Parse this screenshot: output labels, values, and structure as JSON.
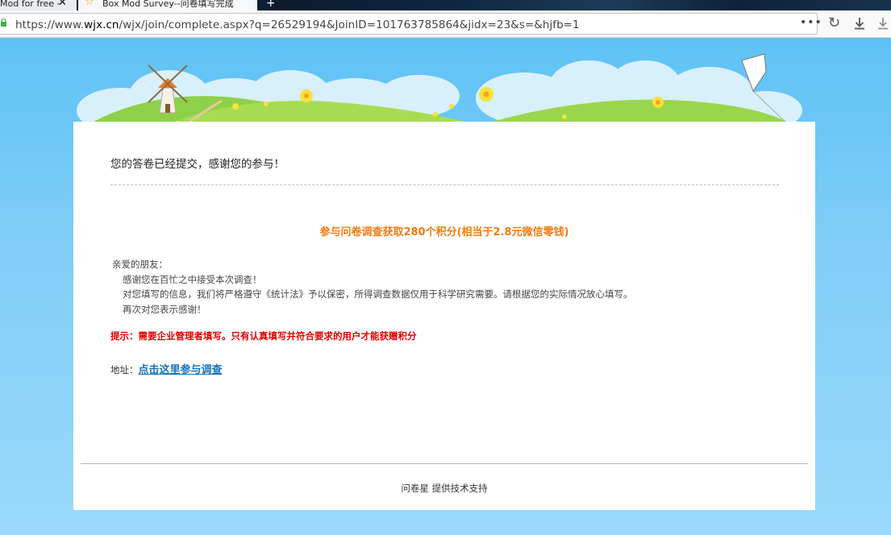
{
  "browser": {
    "tabs": [
      {
        "title": "Mod for free -"
      },
      {
        "title": "Box Mod Survey--问卷填写完成"
      }
    ],
    "url_prefix": "https://www.",
    "url_domain": "wjx.cn",
    "url_path": "/wjx/join/complete.aspx?q=26529194&JoinID=101763785864&jidx=23&s=&hjfb=1",
    "menu_glyph": "•••",
    "colors": {
      "lock": "#3db542",
      "star": "#e8a012"
    }
  },
  "page": {
    "complete_message": "您的答卷已经提交，感谢您的参与！",
    "points_title": "参与问卷调查获取280个积分(相当于2.8元微信零钱)",
    "letter": {
      "greeting": "亲爱的朋友：",
      "line1": "感谢您在百忙之中接受本次调查！",
      "line2": "对您填写的信息，我们将严格遵守《统计法》予以保密，所得调查数据仅用于科学研究需要。请根据您的实际情况放心填写。",
      "line3": "再次对您表示感谢！"
    },
    "hint": "提示：需要企业管理者填写。只有认真填写并符合要求的用户才能获赠积分",
    "address_label": "地址：",
    "address_link": "点击这里参与调查",
    "footer": "问卷星 提供技术支持",
    "colors": {
      "points": "#f07b10",
      "hint": "#e30000",
      "link": "#1a73b5"
    }
  }
}
